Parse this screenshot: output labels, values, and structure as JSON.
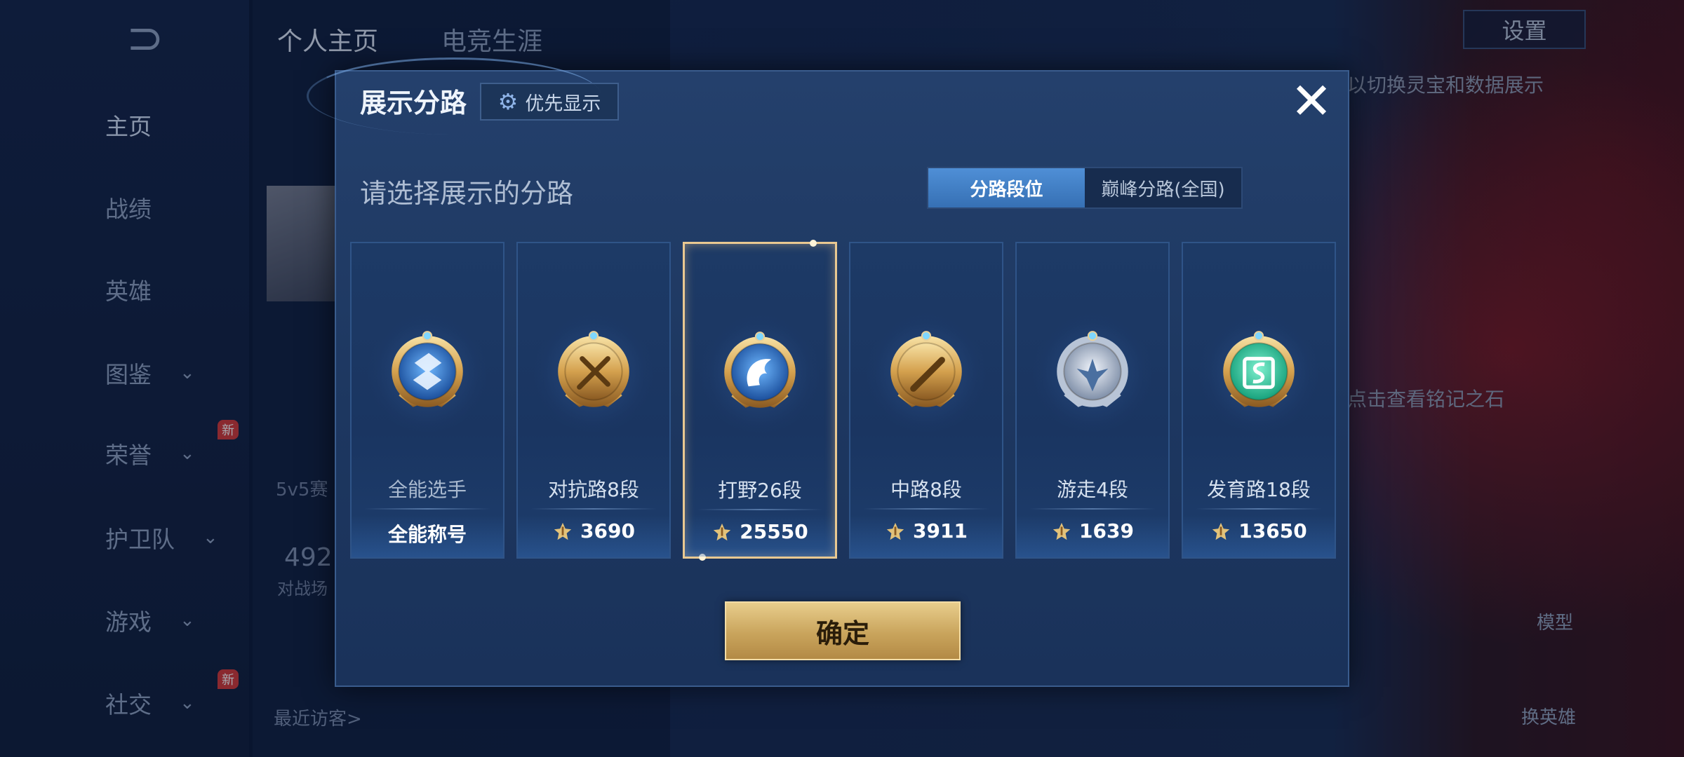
{
  "background": {
    "nav_back_glyph": "⊃",
    "top_tabs": [
      "个人主页",
      "电竞生涯"
    ],
    "nav_items": [
      {
        "label": "主页",
        "active": true,
        "chevron": false
      },
      {
        "label": "战绩",
        "active": false,
        "chevron": false
      },
      {
        "label": "英雄",
        "active": false,
        "chevron": false
      },
      {
        "label": "图鉴",
        "active": false,
        "chevron": true
      },
      {
        "label": "荣誉",
        "active": false,
        "chevron": true,
        "badge": "新"
      },
      {
        "label": "护卫队",
        "active": false,
        "chevron": true
      },
      {
        "label": "游戏",
        "active": false,
        "chevron": true
      },
      {
        "label": "社交",
        "active": false,
        "chevron": true,
        "badge": "新"
      }
    ],
    "chevron_glyph": "⌄",
    "settings_label": "设置",
    "hint_top": "以切换灵宝和数据展示",
    "hint_mid": "点击查看铭记之石",
    "mode_label": "5v5赛",
    "stat_number": "492",
    "stat_label": "对战场",
    "visitors_label": "最近访客>",
    "side_label_model": "模型",
    "side_label_swap": "换英雄"
  },
  "modal": {
    "title": "展示分路",
    "priority_label": "优先显示",
    "priority_icon": "gear-icon",
    "close_glyph": "✕",
    "subtitle": "请选择展示的分路",
    "toggle": {
      "options": [
        "分路段位",
        "巅峰分路(全国)"
      ],
      "selected_index": 0
    },
    "confirm_label": "确定"
  },
  "lanes": [
    {
      "name": "全能选手",
      "value": "全能称号",
      "show_score_icon": false,
      "medal": "allround-medal-icon",
      "selected": false
    },
    {
      "name": "对抗路8段",
      "value": "3690",
      "show_score_icon": true,
      "medal": "clash-lane-medal-icon",
      "selected": false
    },
    {
      "name": "打野26段",
      "value": "25550",
      "show_score_icon": true,
      "medal": "jungle-medal-icon",
      "selected": true
    },
    {
      "name": "中路8段",
      "value": "3911",
      "show_score_icon": true,
      "medal": "mid-lane-medal-icon",
      "selected": false
    },
    {
      "name": "游走4段",
      "value": "1639",
      "show_score_icon": true,
      "medal": "roam-medal-icon",
      "selected": false
    },
    {
      "name": "发育路18段",
      "value": "13650",
      "show_score_icon": true,
      "medal": "farm-lane-medal-icon",
      "selected": false
    }
  ],
  "colors": {
    "accent_blue": "#3670b4",
    "gold": "#c9a45c",
    "selected_border": "#e9c891",
    "modal_bg": "#1d3760"
  }
}
